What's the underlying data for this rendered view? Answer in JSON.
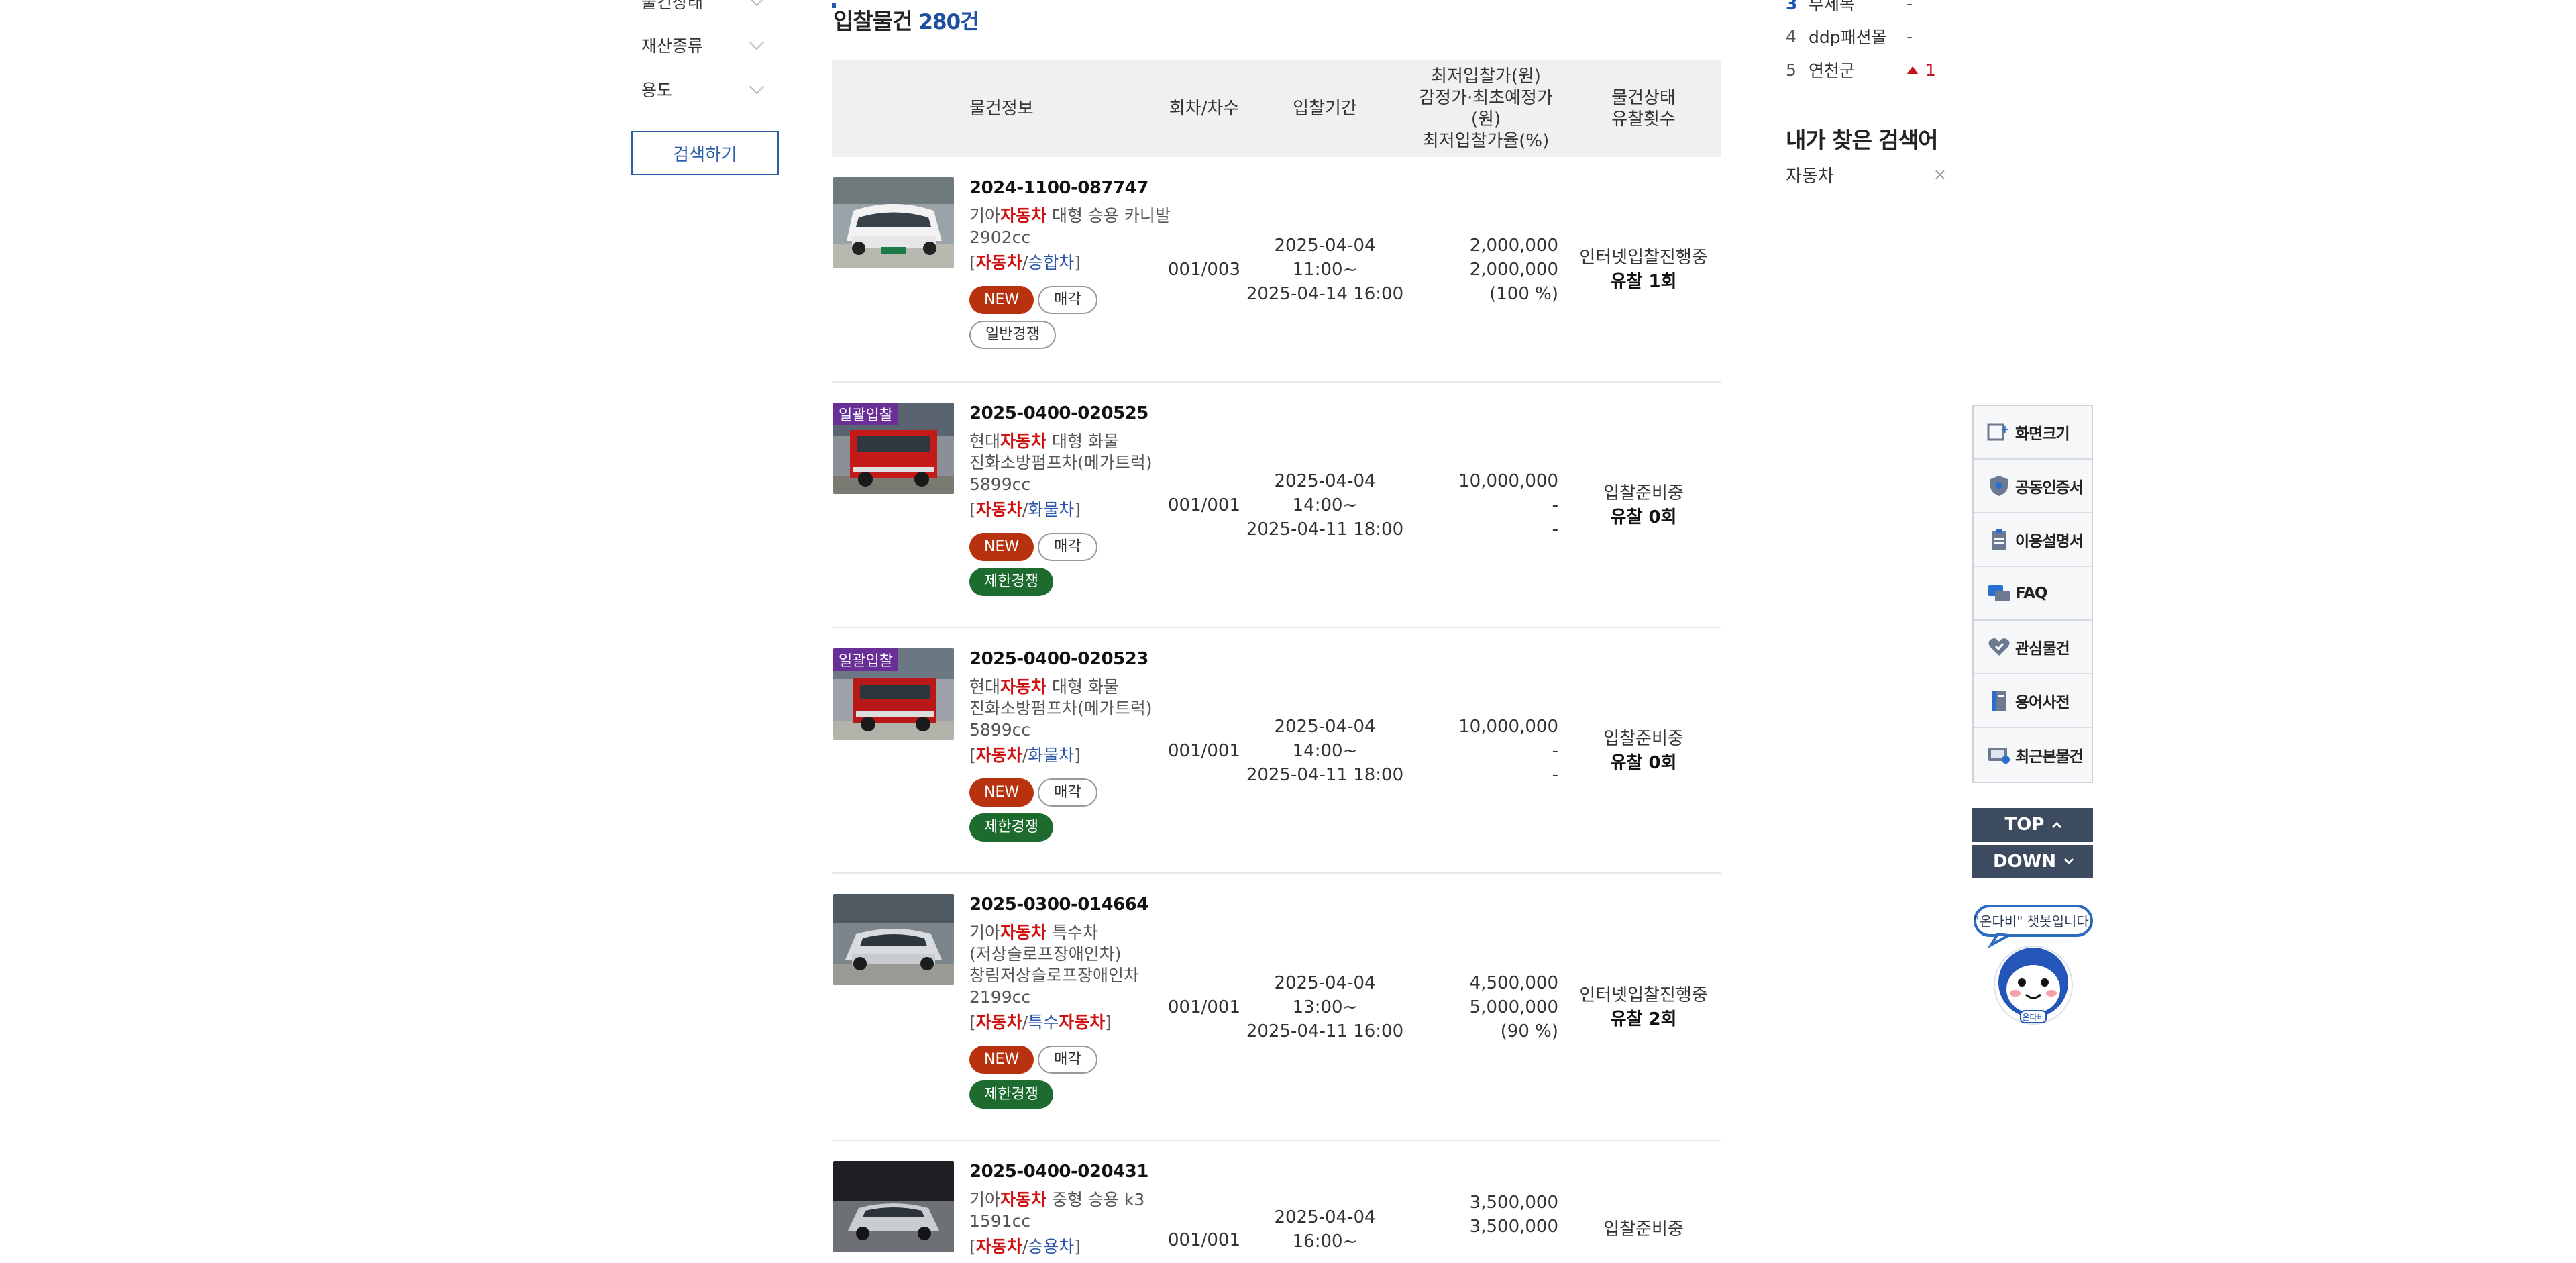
{
  "filters": {
    "items": [
      {
        "label": "물건상태"
      },
      {
        "label": "재산종류"
      },
      {
        "label": "용도"
      }
    ],
    "search_label": "검색하기"
  },
  "list": {
    "title": "입찰물건",
    "count": "280건",
    "headers": {
      "info": "물건정보",
      "round": "회차/차수",
      "period": "입찰기간",
      "price_line1": "최저입찰가(원)",
      "price_line2": "감정가·최초예정가(원)",
      "price_line3": "최저입찰가율(%)",
      "status_line1": "물건상태",
      "status_line2": "유찰횟수"
    },
    "rows": [
      {
        "no": "2024-1100-087747",
        "maker": "기아",
        "keyword": "자동차",
        "desc": [
          " 대형 승용 카니발",
          "2902cc"
        ],
        "cat1": "자동차",
        "cat2": "승합차",
        "ribbon": "",
        "new": "NEW",
        "sale": "매각",
        "compete": "일반경쟁",
        "compete_type": "gen",
        "round": "001/003",
        "start": "2025-04-04 11:00~",
        "end": "2025-04-14 16:00",
        "price": "2,000,000",
        "appraisal": "2,000,000",
        "rate": "(100 %)",
        "status": "인터넷입찰진행중",
        "fail": "유찰 1회"
      },
      {
        "no": "2025-0400-020525",
        "maker": "현대",
        "keyword": "자동차",
        "desc": [
          " 대형 화물",
          "진화소방펌프차(메가트럭)",
          "5899cc"
        ],
        "cat1": "자동차",
        "cat2": "화물차",
        "ribbon": "일괄입찰",
        "new": "NEW",
        "sale": "매각",
        "compete": "제한경쟁",
        "compete_type": "lim",
        "round": "001/001",
        "start": "2025-04-04 14:00~",
        "end": "2025-04-11 18:00",
        "price": "10,000,000",
        "appraisal": "-",
        "rate": "-",
        "status": "입찰준비중",
        "fail": "유찰 0회"
      },
      {
        "no": "2025-0400-020523",
        "maker": "현대",
        "keyword": "자동차",
        "desc": [
          " 대형 화물",
          "진화소방펌프차(메가트럭)",
          "5899cc"
        ],
        "cat1": "자동차",
        "cat2": "화물차",
        "ribbon": "일괄입찰",
        "new": "NEW",
        "sale": "매각",
        "compete": "제한경쟁",
        "compete_type": "lim",
        "round": "001/001",
        "start": "2025-04-04 14:00~",
        "end": "2025-04-11 18:00",
        "price": "10,000,000",
        "appraisal": "-",
        "rate": "-",
        "status": "입찰준비중",
        "fail": "유찰 0회"
      },
      {
        "no": "2025-0300-014664",
        "maker": "기아",
        "keyword": "자동차",
        "desc": [
          " 특수차",
          "(저상슬로프장애인차)",
          "창림저상슬로프장애인차",
          "2199cc"
        ],
        "cat1": "자동차",
        "cat2": "특수",
        "cat2b": "자동차",
        "ribbon": "",
        "new": "NEW",
        "sale": "매각",
        "compete": "제한경쟁",
        "compete_type": "lim",
        "round": "001/001",
        "start": "2025-04-04 13:00~",
        "end": "2025-04-11 16:00",
        "price": "4,500,000",
        "appraisal": "5,000,000",
        "rate": "(90 %)",
        "status": "인터넷입찰진행중",
        "fail": "유찰 2회"
      },
      {
        "no": "2025-0400-020431",
        "maker": "기아",
        "keyword": "자동차",
        "desc": [
          " 중형 승용 k3",
          "1591cc"
        ],
        "cat1": "자동차",
        "cat2": "승용차",
        "ribbon": "",
        "round": "001/001",
        "start": "2025-04-04 16:00~",
        "price": "3,500,000",
        "appraisal": "3,500,000",
        "status": "입찰준비중"
      }
    ]
  },
  "ranking": {
    "items": [
      {
        "num": "3",
        "name": "부세목",
        "chg": "-"
      },
      {
        "num": "4",
        "name": "ddp패션몰",
        "chg": "-"
      },
      {
        "num": "5",
        "name": "연천군",
        "chg": "1"
      }
    ]
  },
  "recent": {
    "title": "내가 찾은 검색어",
    "items": [
      {
        "label": "자동차",
        "remove": "×"
      }
    ]
  },
  "quickmenu": {
    "items": [
      {
        "label": "화면크기",
        "icon": "screen-size-icon"
      },
      {
        "label": "공동인증서",
        "icon": "certificate-icon"
      },
      {
        "label": "이용설명서",
        "icon": "manual-icon"
      },
      {
        "label": "FAQ",
        "icon": "faq-icon"
      },
      {
        "label": "관심물건",
        "icon": "heart-icon"
      },
      {
        "label": "용어사전",
        "icon": "dictionary-icon"
      },
      {
        "label": "최근본물건",
        "icon": "recent-view-icon"
      }
    ],
    "top": "TOP",
    "down": "DOWN"
  },
  "chatbot": {
    "bubble": "\"온다비\" 챗봇입니다.",
    "name": "온다비"
  },
  "colors": {
    "accent_blue": "#1e56b0",
    "highlight_red": "#d01111",
    "new_badge": "#b9320f",
    "limited_badge": "#1d6b2e",
    "nav_dark": "#3d4b60",
    "ribbon_purple": "#6a2f97"
  }
}
